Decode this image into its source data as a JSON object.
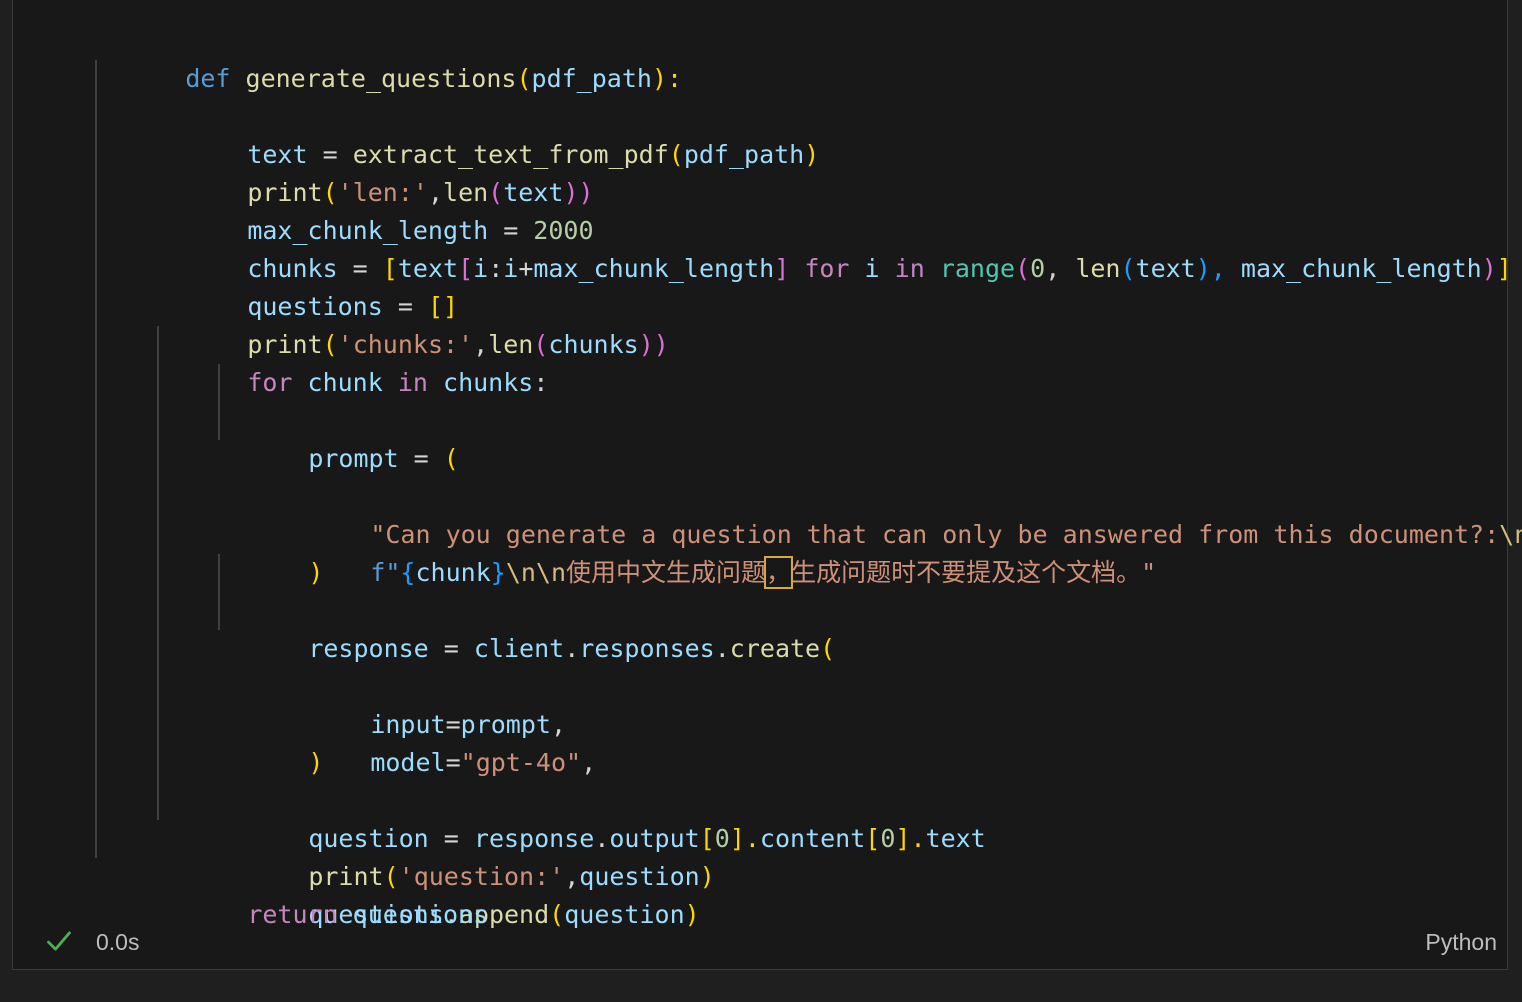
{
  "code": {
    "lines": [
      [
        "def ",
        "generate_questions",
        "(",
        "pdf_path",
        "):"
      ],
      [
        "text",
        " = ",
        "extract_text_from_pdf",
        "(",
        "pdf_path",
        ")"
      ],
      [
        "print",
        "(",
        "'len:'",
        ",",
        "len",
        "(",
        "text",
        "))"
      ],
      [
        "max_chunk_length",
        " = ",
        "2000"
      ],
      [
        "chunks",
        " = ",
        "[",
        "text",
        "[",
        "i",
        ":",
        "i",
        "+",
        "max_chunk_length",
        "]",
        " for ",
        "i",
        " in ",
        "range",
        "(",
        "0",
        ", ",
        "len",
        "(",
        "text",
        "), ",
        "max_chunk_length",
        ")",
        "]"
      ],
      [
        "questions",
        " = ",
        "[]"
      ],
      [
        "print",
        "(",
        "'chunks:'",
        ",",
        "len",
        "(",
        "chunks",
        "))"
      ],
      [
        "for ",
        "chunk",
        " in ",
        "chunks",
        ":"
      ],
      [
        "prompt",
        " = ",
        "("
      ],
      [
        "\"Can you generate a question that can only be answered from this document?:",
        "\\n",
        "\""
      ],
      [
        "f\"",
        "{",
        "chunk",
        "}",
        "\\n\\n",
        "使用中文生成问题",
        "，",
        "生成问题时不要提及这个文档。\""
      ],
      [
        ")"
      ],
      [],
      [
        "response",
        " = ",
        "client",
        ".",
        "responses",
        ".",
        "create",
        "("
      ],
      [
        "input",
        "=",
        "prompt",
        ","
      ],
      [
        "model",
        "=",
        "\"gpt-4o\"",
        ","
      ],
      [
        ")"
      ],
      [],
      [
        "question",
        " = ",
        "response",
        ".",
        "output",
        "[",
        "0",
        "].",
        "content",
        "[",
        "0",
        "].",
        "text"
      ],
      [
        "print",
        "(",
        "'question:'",
        ",",
        "question",
        ")"
      ],
      [
        "questions",
        ".",
        "append",
        "(",
        "question",
        ")"
      ],
      [
        "return ",
        "questions"
      ]
    ]
  },
  "status": {
    "icon": "check-icon",
    "duration": "0.0s",
    "language": "Python",
    "success_color": "#4caf50"
  }
}
